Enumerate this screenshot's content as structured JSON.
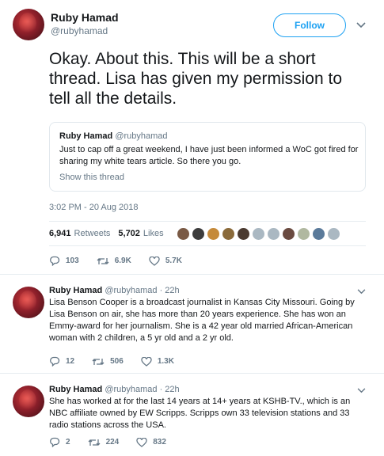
{
  "main_tweet": {
    "author_name": "Ruby Hamad",
    "author_handle": "@rubyhamad",
    "follow_label": "Follow",
    "text": "Okay. About this. This will be a short thread. Lisa has given my permission to tell all the details.",
    "quoted": {
      "author_name": "Ruby Hamad",
      "author_handle": "@rubyhamad",
      "text": "Just to cap off a great weekend, I have just been informed a WoC got fired for sharing my white tears article.  So there you go.",
      "show_thread_label": "Show this thread"
    },
    "timestamp": "3:02 PM - 20 Aug 2018",
    "retweets_count": "6,941",
    "retweets_label": "Retweets",
    "likes_count": "5,702",
    "likes_label": "Likes",
    "liker_colors": [
      "#7a5a45",
      "#3c3c3c",
      "#c58a3a",
      "#8a6a3a",
      "#4a3a30",
      "#aab8c2",
      "#aab8c2",
      "#6a4a40",
      "#b0b8a0",
      "#5a7a9a",
      "#aab8c2"
    ],
    "actions": {
      "replies": "103",
      "retweets": "6.9K",
      "likes": "5.7K"
    }
  },
  "replies": [
    {
      "author_name": "Ruby Hamad",
      "handle_time": "@rubyhamad · 22h",
      "text": "Lisa Benson Cooper is a broadcast journalist in Kansas City Missouri. Going by Lisa Benson on air, she has more than 20 years experience. She has won an Emmy-award for her journalism. She is a 42 year old married African-American woman with 2 children, a 5 yr old and a 2 yr old.",
      "actions": {
        "replies": "12",
        "retweets": "506",
        "likes": "1.3K"
      }
    },
    {
      "author_name": "Ruby Hamad",
      "handle_time": "@rubyhamad · 22h",
      "text": "She has worked at for the last 14 years at 14+ years at KSHB-TV., which is an NBC affiliate owned by EW Scripps. Scripps own 33 television stations and 33 radio stations across the USA.",
      "actions": {
        "replies": "2",
        "retweets": "224",
        "likes": "832"
      }
    }
  ],
  "colors": {
    "accent": "#1da1f2",
    "muted": "#657786",
    "text": "#14171a",
    "border": "#e6ecf0"
  },
  "icons": [
    "chevron-down-icon",
    "reply-icon",
    "retweet-icon",
    "heart-icon"
  ]
}
